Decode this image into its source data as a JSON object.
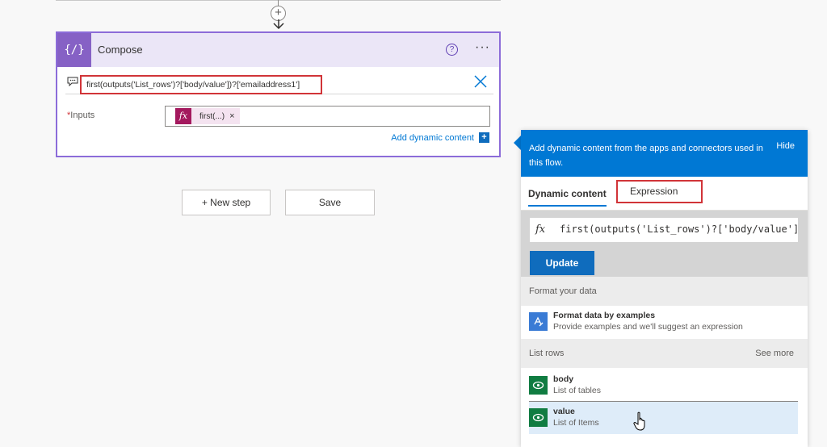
{
  "canvas": {
    "add_step_symbol": "+"
  },
  "compose": {
    "title": "Compose",
    "icon_text": "{/}",
    "help_symbol": "?",
    "more_symbol": "···",
    "expression_text": "first(outputs('List_rows')?['body/value'])?['emailaddress1']",
    "inputs_required_marker": "*",
    "inputs_label": "Inputs",
    "token_fx": "fx",
    "token_label": "first(...)",
    "token_remove": "×",
    "add_dynamic_label": "Add dynamic content",
    "add_dynamic_symbol": "+"
  },
  "actions": {
    "new_step_label": "+ New step",
    "save_label": "Save"
  },
  "panel": {
    "header_text": "Add dynamic content from the apps and connectors used in this flow.",
    "hide_label": "Hide",
    "tabs": [
      {
        "label": "Dynamic content",
        "active": true
      },
      {
        "label": "Expression",
        "active": false
      }
    ],
    "expression": {
      "fx": "fx",
      "code": "first(outputs('List_rows')?['body/value'])"
    },
    "update_label": "Update",
    "sections": [
      {
        "label": "Format your data",
        "items": [
          {
            "title": "Format data by examples",
            "subtitle": "Provide examples and we'll suggest an expression",
            "icon": "format-data-icon"
          }
        ]
      },
      {
        "label": "List rows",
        "see_more": "See more",
        "items": [
          {
            "title": "body",
            "subtitle": "List of tables",
            "icon": "dataverse-icon"
          },
          {
            "title": "value",
            "subtitle": "List of Items",
            "icon": "dataverse-icon",
            "selected": true
          }
        ]
      }
    ]
  },
  "colors": {
    "accent": "#0078d4",
    "compose_purple": "#8661c5",
    "token_magenta": "#a4195e",
    "highlight_red": "#d13438",
    "dataverse_green": "#107c41"
  }
}
